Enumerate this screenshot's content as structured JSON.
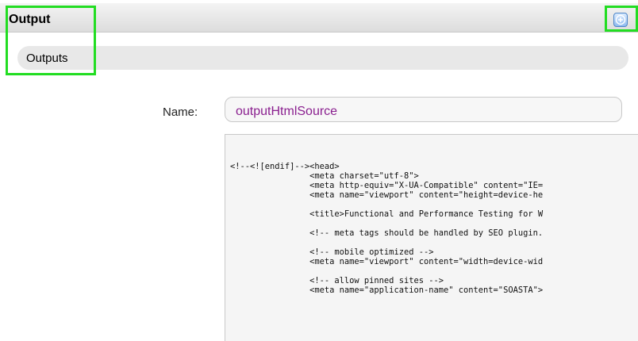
{
  "header": {
    "title": "Output",
    "add_icon": "plus-icon"
  },
  "section": {
    "label": "Outputs"
  },
  "form": {
    "name_label": "Name:",
    "name_value": "outputHtmlSource"
  },
  "source": {
    "code": "<!--<![endif]--><head>\n                <meta charset=\"utf-8\">\n                <meta http-equiv=\"X-UA-Compatible\" content=\"IE=\n                <meta name=\"viewport\" content=\"height=device-he\n\n                <title>Functional and Performance Testing for W\n\n                <!-- meta tags should be handled by SEO plugin.\n\n                <!-- mobile optimized -->\n                <meta name=\"viewport\" content=\"width=device-wid\n\n                <!-- allow pinned sites -->\n                <meta name=\"application-name\" content=\"SOASTA\">"
  },
  "colors": {
    "highlight": "#22dd22",
    "name_value_text": "#8a1f8f",
    "add_button": "#4e86c8"
  }
}
